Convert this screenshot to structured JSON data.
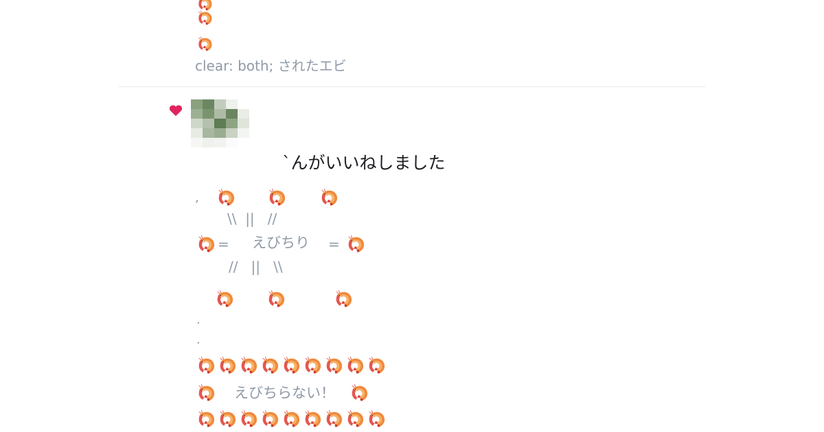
{
  "colors": {
    "text_muted": "#8f9aa7",
    "text_main": "#1d1f23",
    "heart": "#e0245e",
    "separator": "#e6e8ec"
  },
  "top_post": {
    "caption": "clear: both; されたエビ"
  },
  "notification": {
    "heart_icon": "heart-icon",
    "message": "ˋんがいいねしました",
    "art": {
      "art_row_comma": ",",
      "art_row_lines_top": "\\\\  ||   //",
      "art_row_eq_left": "=",
      "art_row_center_text": "えびちり",
      "art_row_eq_right": "=",
      "art_row_lines_bottom": "//   ||   \\\\",
      "dot_1": ".",
      "dot_2": ".",
      "banner_text": "えびちらない！"
    }
  }
}
